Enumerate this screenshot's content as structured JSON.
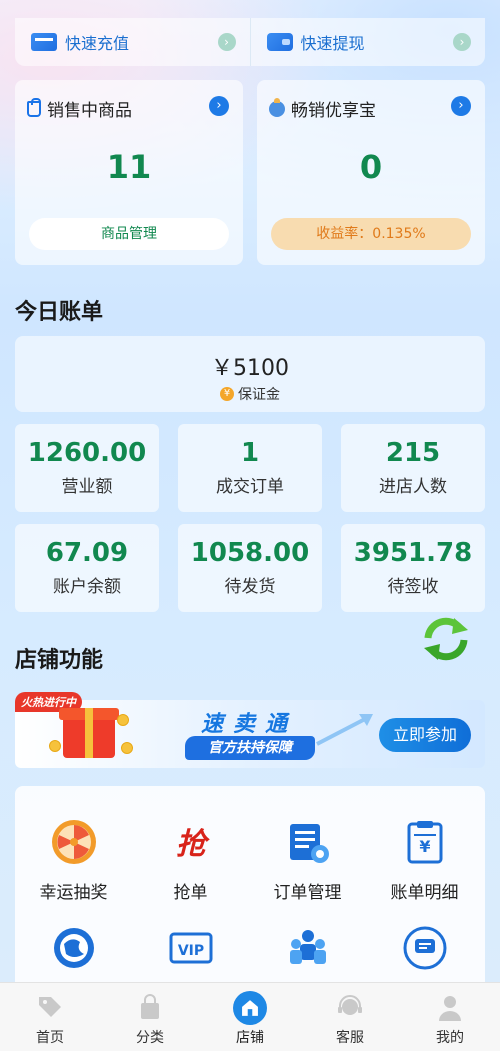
{
  "top_actions": {
    "recharge": "快速充值",
    "withdraw": "快速提现"
  },
  "cards": {
    "selling": {
      "title": "销售中商品",
      "value": "11",
      "button": "商品管理"
    },
    "bestseller": {
      "title": "畅销优享宝",
      "value": "0",
      "button": "收益率：0.135%"
    }
  },
  "today": {
    "title": "今日账单",
    "deposit_amount": "￥5100",
    "deposit_label": "保证金",
    "stats": [
      {
        "value": "1260.00",
        "label": "营业额"
      },
      {
        "value": "1",
        "label": "成交订单"
      },
      {
        "value": "215",
        "label": "进店人数"
      },
      {
        "value": "67.09",
        "label": "账户余额"
      },
      {
        "value": "1058.00",
        "label": "待发货"
      },
      {
        "value": "3951.78",
        "label": "待签收"
      }
    ]
  },
  "store": {
    "title": "店铺功能",
    "banner": {
      "hot_tag": "火热进行中",
      "headline": "速卖通",
      "ribbon": "官方扶持保障",
      "join": "立即参加"
    },
    "functions": [
      {
        "label": "幸运抽奖",
        "icon": "wheel-icon"
      },
      {
        "label": "抢单",
        "icon": "grab-icon"
      },
      {
        "label": "订单管理",
        "icon": "order-icon"
      },
      {
        "label": "账单明细",
        "icon": "bill-icon"
      },
      {
        "label": "",
        "icon": "globe-icon"
      },
      {
        "label": "",
        "icon": "vip-icon"
      },
      {
        "label": "",
        "icon": "team-icon"
      },
      {
        "label": "",
        "icon": "chat-icon"
      }
    ]
  },
  "nav": [
    {
      "label": "首页",
      "icon": "tag-icon"
    },
    {
      "label": "分类",
      "icon": "bag-icon"
    },
    {
      "label": "店铺",
      "icon": "shop-icon"
    },
    {
      "label": "客服",
      "icon": "headset-icon"
    },
    {
      "label": "我的",
      "icon": "user-icon"
    }
  ],
  "colors": {
    "accent_green": "#11884f",
    "accent_blue": "#1e7ae6",
    "orange": "#e07a1a"
  }
}
